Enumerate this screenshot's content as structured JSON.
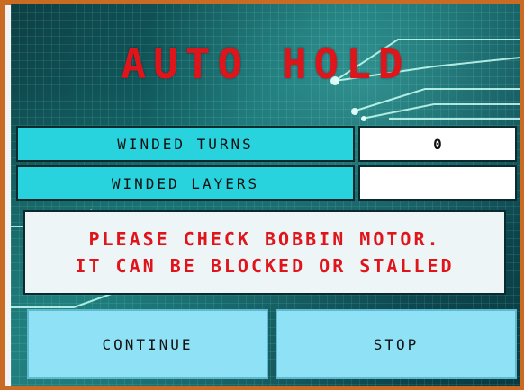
{
  "title": "AUTO HOLD",
  "fields": {
    "winded_turns_label": "WINDED TURNS",
    "winded_turns_value": "0",
    "winded_layers_label": "WINDED LAYERS",
    "winded_layers_value": ""
  },
  "message": {
    "line1": "PLEASE CHECK BOBBIN MOTOR.",
    "line2": "IT CAN BE BLOCKED OR STALLED"
  },
  "buttons": {
    "continue_label": "CONTINUE",
    "stop_label": "STOP"
  },
  "colors": {
    "title": "#e0151c",
    "label_bg": "#28d3de",
    "button_bg": "#8fe2f6",
    "frame": "#c96b22",
    "message_text": "#e0151c"
  }
}
